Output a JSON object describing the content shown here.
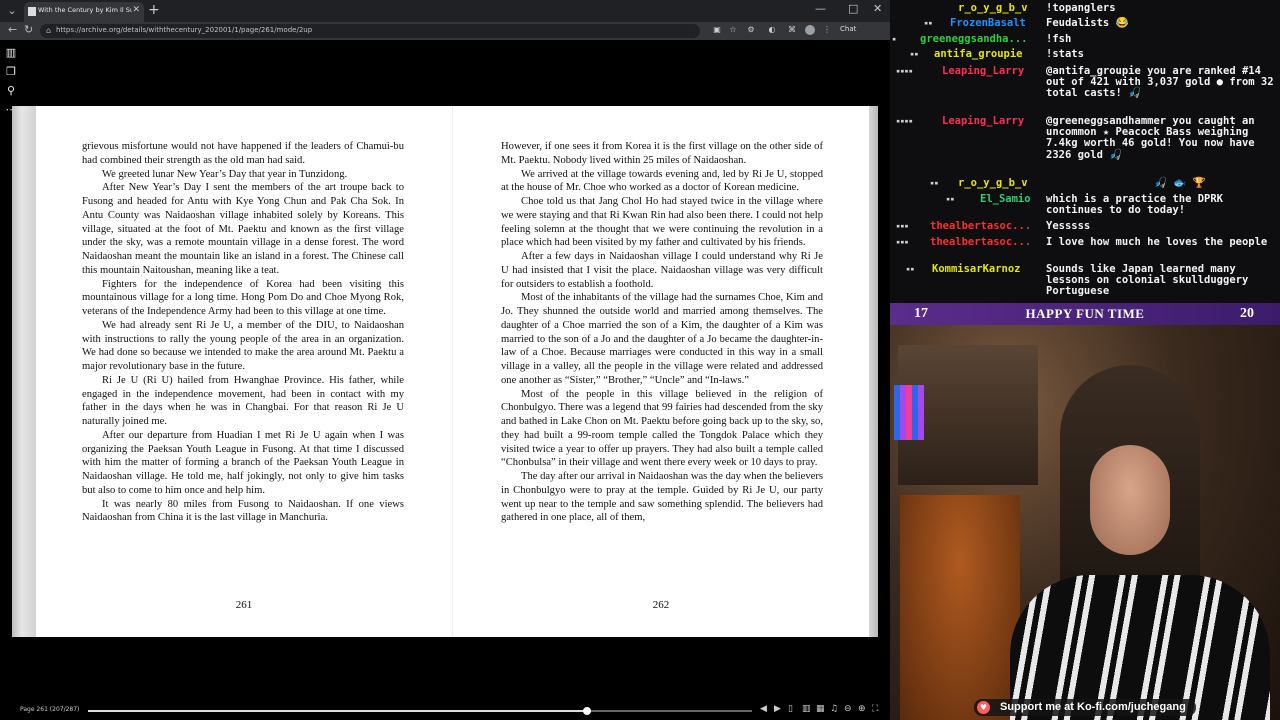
{
  "browser": {
    "tab_title": "With the Century by Kim Il Sung (",
    "url": "https://archive.org/details/withthecentury_202001/1/page/261/mode/2up",
    "chat_button": "Chat",
    "icons": [
      "tab-search-icon",
      "favicon-icon",
      "close-icon",
      "plus-icon",
      "back-icon",
      "reload-icon",
      "lock-icon",
      "minimize-icon",
      "maximize-icon",
      "close-window-icon",
      "extension-icon",
      "profile-icon",
      "menu-icon"
    ]
  },
  "reader": {
    "side_icons": [
      "book-icon",
      "pages-icon",
      "search-icon",
      "more-icon"
    ],
    "left_page": {
      "number": "261",
      "paragraphs": [
        "grievous misfortune would not have happened if the leaders of Chamui-bu had combined their strength as the old man had said.",
        "We greeted lunar New Year’s Day that year in Tunzidong.",
        "After New Year’s Day I sent the members of the art troupe back to Fusong and headed for Antu with Kye Yong Chun and Pak Cha Sok. In Antu County was Naidaoshan village inhabited solely by Koreans. This village, situated at the foot of Mt. Paektu and known as the first village under the sky, was a remote mountain village in a dense forest. The word Naidaoshan meant the mountain like an island in a forest. The Chinese call this mountain Naitoushan, meaning like a teat.",
        "Fighters for the independence of Korea had been visiting this mountainous village for a long time. Hong Pom Do and Choe Myong Rok, veterans of the Independence Army had been to this village at one time.",
        "We had already sent Ri Je U, a member of the DIU, to Naidaoshan with instructions to rally the young people of the area in an organization. We had done so because we intended to make the area around Mt. Paektu a major revolutionary base in the future.",
        "Ri Je U (Ri U) hailed from Hwanghae Province. His father, while engaged in the independence movement, had been in contact with my father in the days when he was in Changbai. For that reason Ri Je U naturally joined me.",
        "After our departure from Huadian I met Ri Je U again when I was organizing the Paeksan Youth League in Fusong. At that time I discussed with him the matter of forming a branch of the Paeksan Youth League in Naidaoshan village. He told me, half jokingly, not only to give him tasks but also to come to him once and help him.",
        "It was nearly 80 miles from Fusong to Naidaoshan. If one views Naidaoshan from China it is the last village in Manchuria."
      ]
    },
    "right_page": {
      "number": "262",
      "paragraphs": [
        "However, if one sees it from Korea it is the first village on the other side of Mt. Paektu. Nobody lived within 25 miles of Naidaoshan.",
        "We arrived at the village towards evening and, led by Ri Je U, stopped at the house of Mr. Choe who worked as a doctor of Korean medicine.",
        "Choe told us that Jang Chol Ho had stayed twice in the village where we were staying and that Ri Kwan Rin had also been there. I could not help feeling solemn at the thought that we were continuing the revolution in a place which had been visited by my father and cultivated by his friends.",
        "After a few days in Naidaoshan village I could understand why Ri Je U had insisted that I visit the place. Naidaoshan village was very difficult for outsiders to establish a foothold.",
        "Most of the inhabitants of the village had the surnames Choe, Kim and Jo. They shunned the outside world and married among themselves. The daughter of a Choe married the son of a Kim, the daughter of a Kim was married to the son of a Jo and the daughter of a Jo became the daughter-in-law of a Choe. Because marriages were conducted in this way in a small village in a valley, all the people in the village were related and addressed one another as “Sister,” “Brother,” “Uncle” and “In-laws.”",
        "Most of the people in this village believed in the religion of Chonbulgyo. There was a legend that 99 fairies had descended from the sky and bathed in Lake Chon on Mt. Paektu before going back up to the sky, so, they had built a 99-room temple called the Tongdok Palace which they visited twice a year to offer up prayers. They had also built a temple called “Chonbulsa” in their village and went there every week or 10 days to pray.",
        "The day after our arrival in Naidaoshan was the day when the believers in Chonbulgyo were to pray at the temple. Guided by Ri Je U, our party went up near to the temple and saw something splendid. The believers had gathered in one place, all of them,"
      ]
    },
    "bottom": {
      "page_indicator": "Page 261 (207/287)",
      "progress": 0.751,
      "control_icons": [
        "prev-page-icon",
        "next-page-icon",
        "one-page-view-icon",
        "two-page-view-icon",
        "thumbnail-view-icon",
        "read-aloud-icon",
        "zoom-out-icon",
        "zoom-in-icon",
        "fullscreen-icon"
      ]
    }
  },
  "chat": {
    "messages": [
      {
        "badges": "",
        "user": "r_o_y_g_b_v",
        "color": "#e6e600",
        "text": "!topanglers"
      },
      {
        "badges": "▪▪",
        "user": "FrozenBasalt",
        "color": "#1e90ff",
        "text": "Feudalists 😂"
      },
      {
        "badges": "▪",
        "user": "greeneggsandha...",
        "color": "#2ecc40",
        "text": "!fsh"
      },
      {
        "badges": "▪▪",
        "user": "antifa_groupie",
        "color": "#e6e600",
        "text": "!stats"
      },
      {
        "badges": "▪▪▪▪",
        "user": "Leaping_Larry",
        "color": "#ff2d55",
        "text": "@antifa_groupie you are ranked #14 out of 421 with 3,037 gold ● from 32 total casts! 🎣"
      },
      {
        "badges": "▪▪▪▪",
        "user": "Leaping_Larry",
        "color": "#ff2d55",
        "text": "@greeneggsandhammer you caught an uncommon ★ Peacock Bass weighing 7.4kg worth 46 gold! You now have 2326 gold 🎣"
      },
      {
        "badges": "▪▪",
        "user": "r_o_y_g_b_v",
        "color": "#e6e600",
        "text": "🎣 🐟 🏆"
      },
      {
        "badges": "▪▪",
        "user": "El_Samio",
        "color": "#2ecc71",
        "text": "which is a practice the DPRK continues to do today!"
      },
      {
        "badges": "▪▪▪",
        "user": "thealbertasoc...",
        "color": "#ff2d2d",
        "text": "Yesssss"
      },
      {
        "badges": "▪▪▪",
        "user": "thealbertasoc...",
        "color": "#ff2d2d",
        "text": "I love how much he loves the people"
      },
      {
        "badges": "▪▪",
        "user": "KommisarKarnoz",
        "color": "#e6e600",
        "text": "Sounds like Japan learned many lessons on colonial skullduggery Portuguese"
      }
    ]
  },
  "overlay": {
    "left_num": "17",
    "title": "HAPPY FUN TIME",
    "right_num": "20"
  },
  "kofi": {
    "text": "Support me at Ko-fi.com/juchegang",
    "icon": "ko-fi-cup-icon"
  }
}
